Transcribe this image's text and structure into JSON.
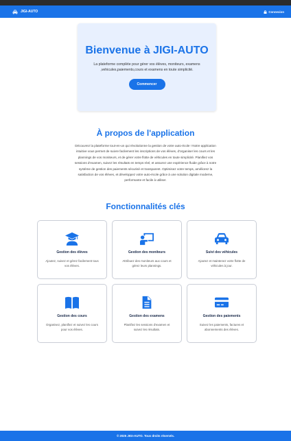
{
  "navbar": {
    "brand": "JIGI-AUTO",
    "login": "Connexion"
  },
  "hero": {
    "title": "Bienvenue à JIGI-AUTO",
    "subtitle": "La plateforme complète pour gérer vos élèves, moniteurs, examens ,vehicules,paiements,cours et examens en toute simplicité.",
    "button": "Commencer"
  },
  "about": {
    "title": "À propos de l'application",
    "text": "Découvrez la plateforme tout-en-un qui révolutionne la gestion de votre auto-école ! Notre application intuitive vous permet de suivre facilement les inscriptions de vos élèves, d'organiser les cours et les plannings de vos moniteurs, et de gérer votre flotte de véhicules en toute simplicité. Planifiez vos sessions d'examen, suivez les résultats en temps réel, et assurez une expérience fluide grâce à notre système de gestion des paiements sécurisé et transparent. Optimisez votre temps, améliorez la satisfaction de vos élèves, et développez votre auto-école grâce à une solution digitale moderne, performante et facile à utiliser."
  },
  "features": {
    "title": "Fonctionnalités clés",
    "items": [
      {
        "icon": "graduate-icon",
        "title": "Gestion des élèves",
        "desc": "Ajoutez, suivez et gérez facilement tous vos élèves."
      },
      {
        "icon": "teacher-board-icon",
        "title": "Gestion des moniteurs",
        "desc": "Attribuez des moniteurs aux cours et gérez leurs plannings."
      },
      {
        "icon": "car-icon",
        "title": "Suivi des véhicules",
        "desc": "Ajoutez et maintenez votre flotte de véhicules à jour."
      },
      {
        "icon": "book-icon",
        "title": "Gestion des cours",
        "desc": "Organisez, planifiez et suivez les cours pour vos élèves."
      },
      {
        "icon": "document-icon",
        "title": "Gestion des examens",
        "desc": "Planifiez les sessions d'examen et suivez les résultats."
      },
      {
        "icon": "credit-card-icon",
        "title": "Gestion des paiements",
        "desc": "Suivez les paiements, factures et abonnements des élèves."
      }
    ]
  },
  "footer": {
    "text": "© 2025 JIGI-AUTO. Tous droits réservés."
  },
  "colors": {
    "primary": "#1a73e8",
    "hero_bg": "#e8f0fe"
  }
}
